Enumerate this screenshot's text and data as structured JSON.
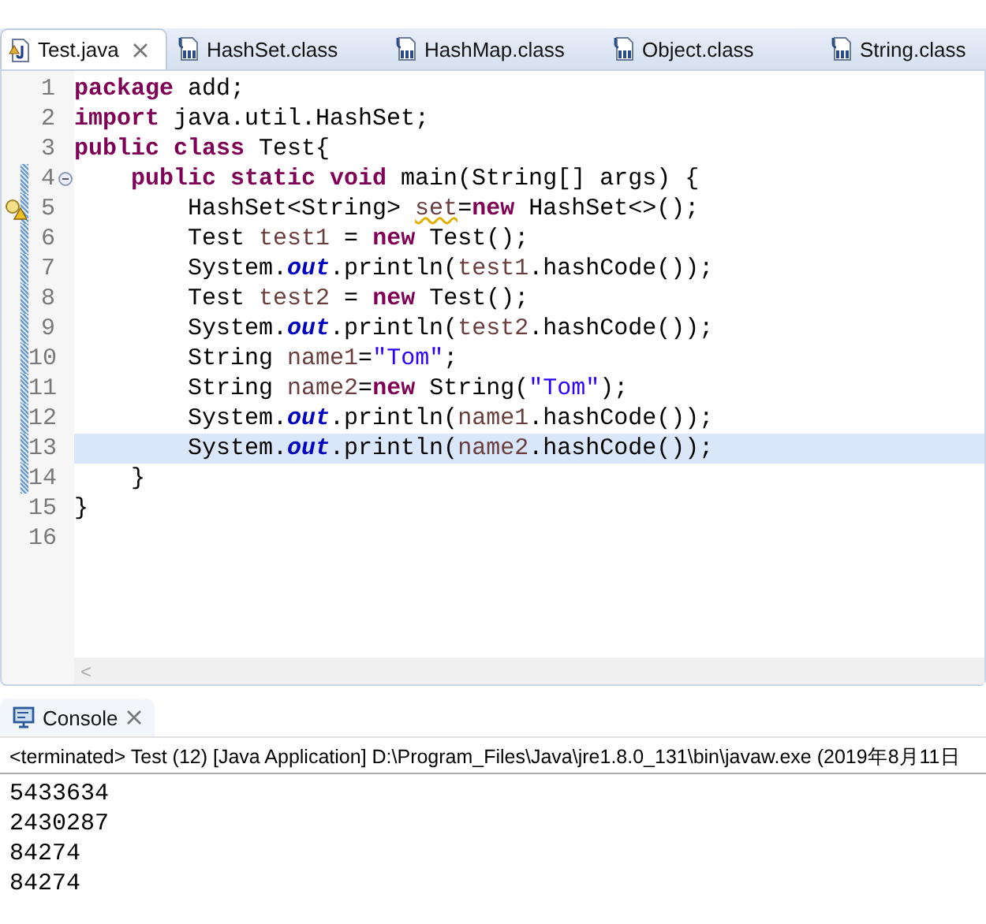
{
  "editor_tabs": [
    {
      "label": "Test.java",
      "kind": "java",
      "selected": true,
      "closable": true
    },
    {
      "label": "HashSet.class",
      "kind": "class",
      "selected": false
    },
    {
      "label": "HashMap.class",
      "kind": "class",
      "selected": false
    },
    {
      "label": "Object.class",
      "kind": "class",
      "selected": false
    },
    {
      "label": "String.class",
      "kind": "class",
      "selected": false
    }
  ],
  "code_lines": [
    {
      "number": "1",
      "marked": false,
      "current": false,
      "tokens": [
        {
          "kind": "keyword",
          "text": "package"
        },
        {
          "kind": "plain",
          "text": " add;"
        }
      ]
    },
    {
      "number": "2",
      "marked": false,
      "current": false,
      "tokens": [
        {
          "kind": "keyword",
          "text": "import"
        },
        {
          "kind": "plain",
          "text": " java.util.HashSet;"
        }
      ]
    },
    {
      "number": "3",
      "marked": false,
      "current": false,
      "tokens": [
        {
          "kind": "keyword",
          "text": "public class"
        },
        {
          "kind": "plain",
          "text": " Test{"
        }
      ]
    },
    {
      "number": "4",
      "marked": true,
      "current": false,
      "fold": true,
      "tokens": [
        {
          "kind": "keyword",
          "text": "    public static void"
        },
        {
          "kind": "plain",
          "text": " main(String[] args) {"
        }
      ]
    },
    {
      "number": "5",
      "marked": true,
      "current": false,
      "warning": true,
      "tokens": [
        {
          "kind": "plain",
          "text": "        HashSet<String> "
        },
        {
          "kind": "warn_local",
          "text": "set"
        },
        {
          "kind": "plain",
          "text": "="
        },
        {
          "kind": "keyword",
          "text": "new"
        },
        {
          "kind": "plain",
          "text": " HashSet<>();"
        }
      ]
    },
    {
      "number": "6",
      "marked": true,
      "current": false,
      "tokens": [
        {
          "kind": "plain",
          "text": "        Test "
        },
        {
          "kind": "local",
          "text": "test1"
        },
        {
          "kind": "plain",
          "text": " = "
        },
        {
          "kind": "keyword",
          "text": "new"
        },
        {
          "kind": "plain",
          "text": " Test();"
        }
      ]
    },
    {
      "number": "7",
      "marked": true,
      "current": false,
      "tokens": [
        {
          "kind": "plain",
          "text": "        System."
        },
        {
          "kind": "static",
          "text": "out"
        },
        {
          "kind": "plain",
          "text": ".println("
        },
        {
          "kind": "local",
          "text": "test1"
        },
        {
          "kind": "plain",
          "text": ".hashCode());"
        }
      ]
    },
    {
      "number": "8",
      "marked": true,
      "current": false,
      "tokens": [
        {
          "kind": "plain",
          "text": "        Test "
        },
        {
          "kind": "local",
          "text": "test2"
        },
        {
          "kind": "plain",
          "text": " = "
        },
        {
          "kind": "keyword",
          "text": "new"
        },
        {
          "kind": "plain",
          "text": " Test();"
        }
      ]
    },
    {
      "number": "9",
      "marked": true,
      "current": false,
      "tokens": [
        {
          "kind": "plain",
          "text": "        System."
        },
        {
          "kind": "static",
          "text": "out"
        },
        {
          "kind": "plain",
          "text": ".println("
        },
        {
          "kind": "local",
          "text": "test2"
        },
        {
          "kind": "plain",
          "text": ".hashCode());"
        }
      ]
    },
    {
      "number": "10",
      "marked": true,
      "current": false,
      "tokens": [
        {
          "kind": "plain",
          "text": "        String "
        },
        {
          "kind": "local",
          "text": "name1"
        },
        {
          "kind": "plain",
          "text": "="
        },
        {
          "kind": "string",
          "text": "\"Tom\""
        },
        {
          "kind": "plain",
          "text": ";"
        }
      ]
    },
    {
      "number": "11",
      "marked": true,
      "current": false,
      "tokens": [
        {
          "kind": "plain",
          "text": "        String "
        },
        {
          "kind": "local",
          "text": "name2"
        },
        {
          "kind": "plain",
          "text": "="
        },
        {
          "kind": "keyword",
          "text": "new"
        },
        {
          "kind": "plain",
          "text": " String("
        },
        {
          "kind": "string",
          "text": "\"Tom\""
        },
        {
          "kind": "plain",
          "text": ");"
        }
      ]
    },
    {
      "number": "12",
      "marked": true,
      "current": false,
      "tokens": [
        {
          "kind": "plain",
          "text": "        System."
        },
        {
          "kind": "static",
          "text": "out"
        },
        {
          "kind": "plain",
          "text": ".println("
        },
        {
          "kind": "local",
          "text": "name1"
        },
        {
          "kind": "plain",
          "text": ".hashCode());"
        }
      ]
    },
    {
      "number": "13",
      "marked": true,
      "current": true,
      "tokens": [
        {
          "kind": "plain",
          "text": "        System."
        },
        {
          "kind": "static",
          "text": "out"
        },
        {
          "kind": "plain",
          "text": ".println("
        },
        {
          "kind": "local",
          "text": "name2"
        },
        {
          "kind": "plain",
          "text": ".hashCode());"
        }
      ]
    },
    {
      "number": "14",
      "marked": true,
      "current": false,
      "tokens": [
        {
          "kind": "plain",
          "text": "    }"
        }
      ]
    },
    {
      "number": "15",
      "marked": false,
      "current": false,
      "tokens": [
        {
          "kind": "plain",
          "text": "}"
        }
      ]
    },
    {
      "number": "16",
      "marked": false,
      "current": false
    }
  ],
  "scroll_arrow": "<",
  "console": {
    "tab": {
      "label": "Console",
      "selected": true
    },
    "status": "<terminated> Test (12) [Java Application] D:\\Program_Files\\Java\\jre1.8.0_131\\bin\\javaw.exe (2019年8月11日",
    "output": [
      "5433634",
      "2430287",
      "84274",
      "84274"
    ]
  }
}
